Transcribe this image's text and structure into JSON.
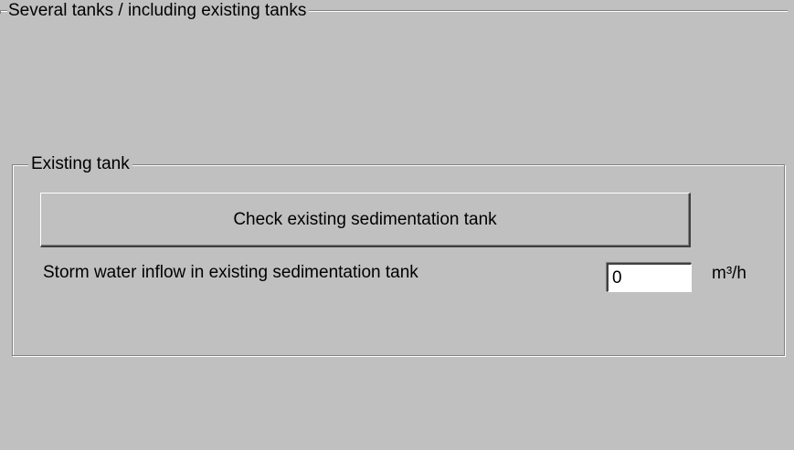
{
  "outer_group": {
    "title": "Several tanks / including existing tanks"
  },
  "existing_tank_group": {
    "title": "Existing tank",
    "check_button_label": "Check existing sedimentation tank",
    "inflow_label": "Storm water inflow in existing sedimentation tank",
    "inflow_value": "0",
    "inflow_unit": "m³/h"
  }
}
